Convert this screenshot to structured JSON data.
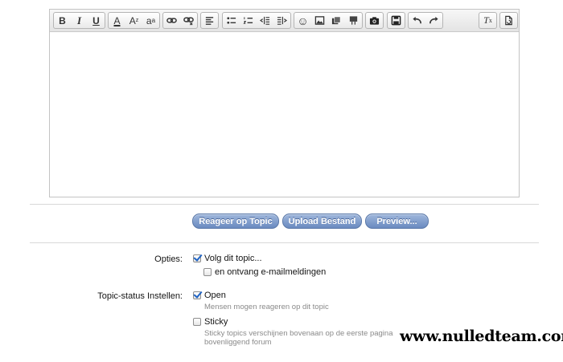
{
  "toolbar": {
    "groups": [
      [
        {
          "name": "bold",
          "glyph": "B"
        },
        {
          "name": "italic",
          "glyph": "I"
        },
        {
          "name": "underline",
          "glyph": "U"
        }
      ],
      [
        {
          "name": "text-color",
          "glyph": "A"
        },
        {
          "name": "font-size",
          "glyph": "A"
        },
        {
          "name": "font-style",
          "glyph": "a"
        }
      ],
      [
        {
          "name": "link",
          "glyph": ""
        },
        {
          "name": "unlink",
          "glyph": ""
        }
      ],
      [
        {
          "name": "align",
          "glyph": ""
        }
      ],
      [
        {
          "name": "bullet-list",
          "glyph": ""
        },
        {
          "name": "numbered-list",
          "glyph": ""
        },
        {
          "name": "outdent",
          "glyph": ""
        },
        {
          "name": "indent",
          "glyph": ""
        }
      ],
      [
        {
          "name": "smiley",
          "glyph": "☺"
        },
        {
          "name": "image",
          "glyph": ""
        },
        {
          "name": "media",
          "glyph": ""
        },
        {
          "name": "quote",
          "glyph": ""
        }
      ],
      [
        {
          "name": "camera",
          "glyph": ""
        }
      ],
      [
        {
          "name": "save",
          "glyph": ""
        }
      ],
      [
        {
          "name": "undo",
          "glyph": "↶"
        },
        {
          "name": "redo",
          "glyph": "↷"
        }
      ],
      [
        {
          "name": "remove-format",
          "glyph": "T"
        }
      ],
      [
        {
          "name": "restore",
          "glyph": ""
        }
      ]
    ]
  },
  "buttons": {
    "reply": "Reageer op Topic",
    "upload": "Upload Bestand",
    "preview": "Preview..."
  },
  "options": {
    "label": "Opties:",
    "follow": {
      "text": "Volg dit topic...",
      "checked": true
    },
    "email": {
      "text": "en ontvang e-mailmeldingen",
      "checked": false
    }
  },
  "status": {
    "label": "Topic-status Instellen:",
    "open": {
      "text": "Open",
      "checked": true,
      "hint": "Mensen mogen reageren op dit topic"
    },
    "sticky": {
      "text": "Sticky",
      "checked": false,
      "hint": "Sticky topics verschijnen bovenaan op de eerste pagina",
      "hint2": "bovenliggend forum"
    }
  },
  "watermark": "www.nulledteam.com"
}
